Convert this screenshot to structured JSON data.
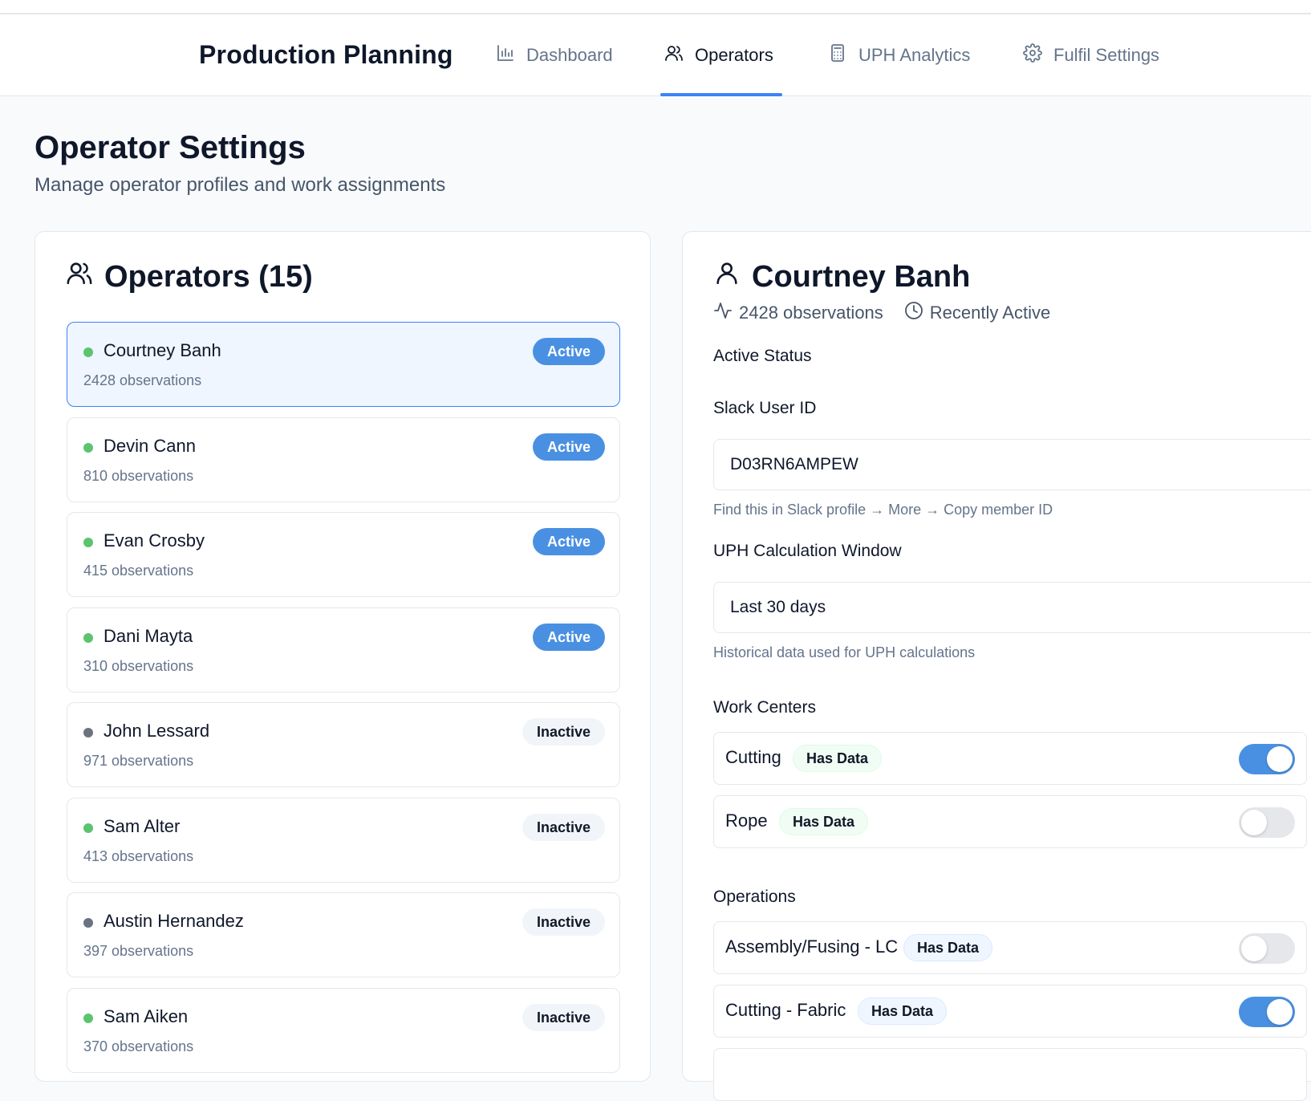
{
  "header": {
    "brand": "Production Planning",
    "tabs": [
      {
        "label": "Dashboard",
        "icon": "bar-chart-icon",
        "active": false
      },
      {
        "label": "Operators",
        "icon": "users-icon",
        "active": true
      },
      {
        "label": "UPH Analytics",
        "icon": "calculator-icon",
        "active": false
      },
      {
        "label": "Fulfil Settings",
        "icon": "gear-icon",
        "active": false
      }
    ]
  },
  "page": {
    "title": "Operator Settings",
    "subtitle": "Manage operator profiles and work assignments"
  },
  "operators_panel": {
    "title": "Operators (15)",
    "items": [
      {
        "name": "Courtney Banh",
        "observations": "2428 observations",
        "status": "Active",
        "dot_color": "#5cc46e",
        "selected": true
      },
      {
        "name": "Devin Cann",
        "observations": "810 observations",
        "status": "Active",
        "dot_color": "#5cc46e"
      },
      {
        "name": "Evan Crosby",
        "observations": "415 observations",
        "status": "Active",
        "dot_color": "#5cc46e"
      },
      {
        "name": "Dani Mayta",
        "observations": "310 observations",
        "status": "Active",
        "dot_color": "#5cc46e"
      },
      {
        "name": "John Lessard",
        "observations": "971 observations",
        "status": "Inactive",
        "dot_color": "#6b7280"
      },
      {
        "name": "Sam Alter",
        "observations": "413 observations",
        "status": "Inactive",
        "dot_color": "#5cc46e"
      },
      {
        "name": "Austin Hernandez",
        "observations": "397 observations",
        "status": "Inactive",
        "dot_color": "#6b7280"
      },
      {
        "name": "Sam Aiken",
        "observations": "370 observations",
        "status": "Inactive",
        "dot_color": "#5cc46e"
      }
    ]
  },
  "detail": {
    "name": "Courtney Banh",
    "observations": "2428 observations",
    "activity": "Recently Active",
    "active_status_label": "Active Status",
    "slack_label": "Slack User ID",
    "slack_value": "D03RN6AMPEW",
    "slack_hint": "Find this in Slack profile → More → Copy member ID",
    "uph_label": "UPH Calculation Window",
    "uph_value": "Last 30 days",
    "uph_hint": "Historical data used for UPH calculations",
    "work_centers_label": "Work Centers",
    "work_centers": [
      {
        "name": "Cutting",
        "badge": "Has Data",
        "on": true
      },
      {
        "name": "Rope",
        "badge": "Has Data",
        "on": false
      }
    ],
    "operations_label": "Operations",
    "operations": [
      {
        "name": "Assembly/Fusing - LC",
        "badge": "Has Data",
        "on": false
      },
      {
        "name": "Cutting - Fabric",
        "badge": "Has Data",
        "on": true
      }
    ]
  },
  "colors": {
    "accent": "#3b82f6",
    "badge_active": "#4a90e2",
    "dot_active": "#5cc46e",
    "dot_inactive": "#6b7280"
  }
}
